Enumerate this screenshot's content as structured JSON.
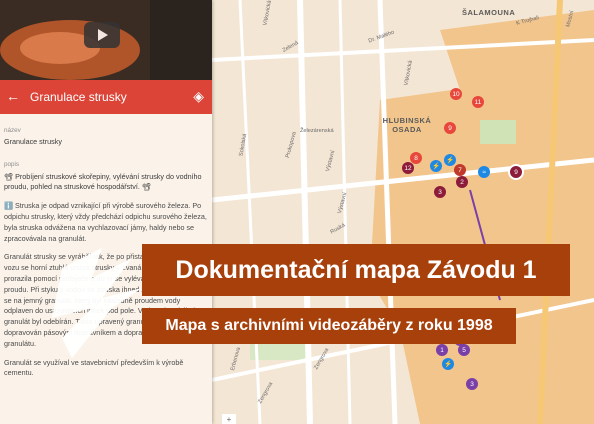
{
  "header": {
    "title": "Granulace strusky",
    "back_icon": "arrow-back-icon",
    "directions_icon": "directions-icon"
  },
  "fields": {
    "name_label": "název",
    "name_value": "Granulace strusky",
    "desc_label": "popis",
    "desc_line1": "📽 Probíjení struskové skořepiny, vylévání strusky do vodního proudu, pohled na struskové hospodářství. 📽",
    "desc_para1": "ℹ️ Struska je odpad vznikající při výrobě surového železa. Po odpichu strusky, který vždy předchází odpichu surového železa, byla struska odvážena na vychlazovací jámy, haldy nebo se zpracovávala na granulát.",
    "desc_para2": "Granulát strusky se vyráběl tak, že po přistavení struskového vozu se horní ztuhlá vrstva strusky – zvaná skořepina – prorazila pomocí probíječe a do ní se vylévala do vodního proudu. Při styku s vodou se struska ihned zchladila a rozpadla se na jemný granulát, který byl následně proudem vody odplaven do usazovacích jímek pod pole. Voda pole odtékala a granulát byl odebírán. Takto upravený granulačního pole pak dopravován pásovým dopravníkem a dopravován do zásobníků granulátu.",
    "desc_para3": "Granulát se využíval ve stavebnictví především k výrobě cementu."
  },
  "banner": {
    "title": "Dokumentační mapa Závodu 1",
    "subtitle": "Mapa s archivními videozáběry z roku 1998"
  },
  "map": {
    "district_labels": [
      "ŠALAMOUNA",
      "HLUBINSKÁ OSADA"
    ],
    "streets": [
      "Vítkovická",
      "Zelená",
      "Dr. Malého",
      "Mostní",
      "K Trojhali",
      "Vítkovická",
      "Železárenská",
      "Sokolská",
      "Výstavní",
      "Prokopova",
      "Ruská",
      "Výstavní",
      "Erbenova",
      "Zengrova",
      "Zengrova"
    ],
    "marker_numbers": [
      "10",
      "11",
      "9",
      "8",
      "12",
      "7",
      "3",
      "2",
      "1",
      "6",
      "9",
      "5",
      "3"
    ],
    "zoom_label": "+"
  },
  "colors": {
    "accent": "#db4437",
    "banner": "#a8400c",
    "map_bg": "#f4e6d4",
    "area": "#f2c58d"
  }
}
